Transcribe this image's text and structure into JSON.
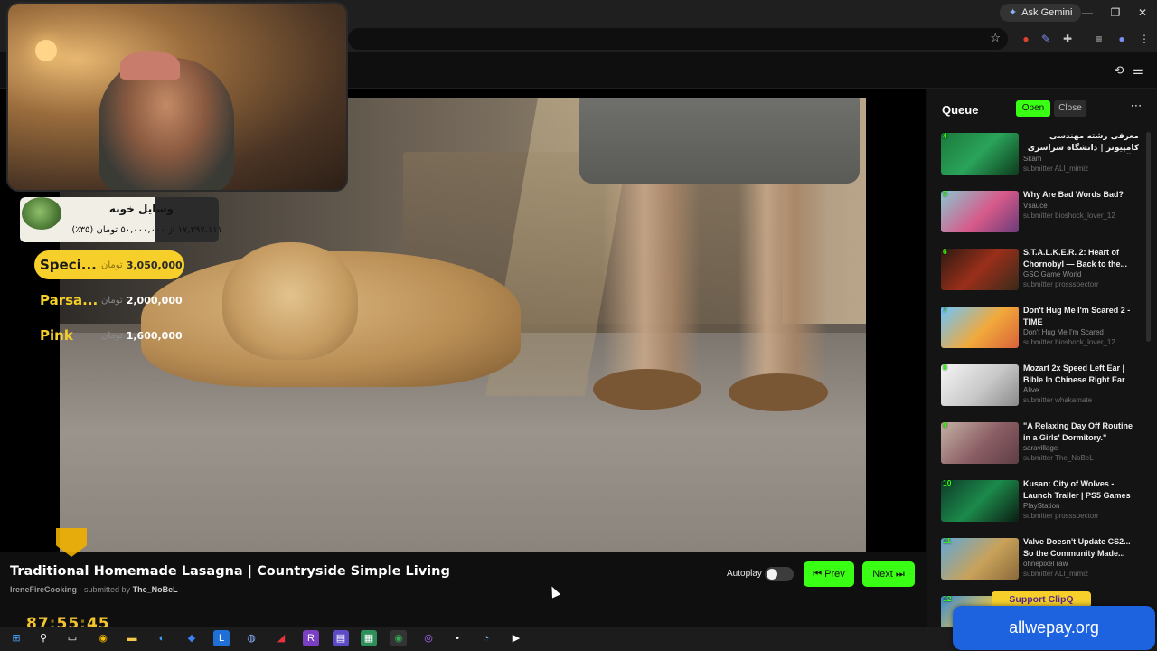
{
  "browser": {
    "gemini_label": "Ask Gemini",
    "window_controls": {
      "minimize": "—",
      "restore": "❐",
      "close": "✕"
    }
  },
  "donation": {
    "title": "وسایل خونه",
    "progress_text": "۱۷,۳۹۷.۱۱۱ از ۵۰,۰۰۰,۰۰۰ تومان (۳۵٪)"
  },
  "tiers": [
    {
      "name": "Speci...",
      "currency": "تومان",
      "amount": "3,050,000"
    },
    {
      "name": "Parsa...",
      "currency": "تومان",
      "amount": "2,000,000"
    },
    {
      "name": "Pink",
      "currency": "تومان",
      "amount": "1,600,000"
    }
  ],
  "video": {
    "title": "Traditional Homemade Lasagna | Countryside Simple Living",
    "channel": "IreneFireCooking",
    "submitted_by_label": "- submitted by",
    "submitter": "The_NoBeL"
  },
  "controls": {
    "autoplay_label": "Autoplay",
    "autoplay_on": false,
    "prev_label": "Prev",
    "next_label": "Next",
    "accent_color": "#39ff14"
  },
  "timer": {
    "hours": "87",
    "minutes": "55",
    "seconds": "45"
  },
  "queue": {
    "title": "Queue",
    "open_label": "Open",
    "close_label": "Close",
    "items": [
      {
        "num": "4",
        "title": "معرفی رشته مهندسی کامپیوتر | دانشگاه سراسری یا آزاد؟؟؟",
        "channel": "Skam",
        "submitter": "submitter ALI_mimiz"
      },
      {
        "num": "5",
        "title": "Why Are Bad Words Bad?",
        "channel": "Vsauce",
        "submitter": "submitter bioshock_lover_12"
      },
      {
        "num": "6",
        "title": "S.T.A.L.K.E.R. 2: Heart of Chornobyl — Back to the...",
        "channel": "GSC Game World",
        "submitter": "submitter prossspectorr"
      },
      {
        "num": "7",
        "title": "Don't Hug Me I'm Scared 2 - TIME",
        "channel": "Don't Hug Me I'm Scared",
        "submitter": "submitter bioshock_lover_12"
      },
      {
        "num": "8",
        "title": "Mozart 2x Speed Left Ear | Bible In Chinese Right Ear",
        "channel": "Alive",
        "submitter": "submitter whakamate"
      },
      {
        "num": "9",
        "title": "\"A Relaxing Day Off Routine in a Girls' Dormitory.\"",
        "channel": "saravillage",
        "submitter": "submitter The_NoBeL"
      },
      {
        "num": "10",
        "title": "Kusan: City of Wolves - Launch Trailer | PS5 Games",
        "channel": "PlayStation",
        "submitter": "submitter prossspectorr"
      },
      {
        "num": "11",
        "title": "Valve Doesn't Update CS2... So the Community Made...",
        "channel": "ohnepixel raw",
        "submitter": "submitter ALI_mimiz"
      },
      {
        "num": "12",
        "title": "",
        "channel": "",
        "submitter": ""
      }
    ]
  },
  "support_label": "Support ClipQ",
  "watermark": "allwepay.org"
}
